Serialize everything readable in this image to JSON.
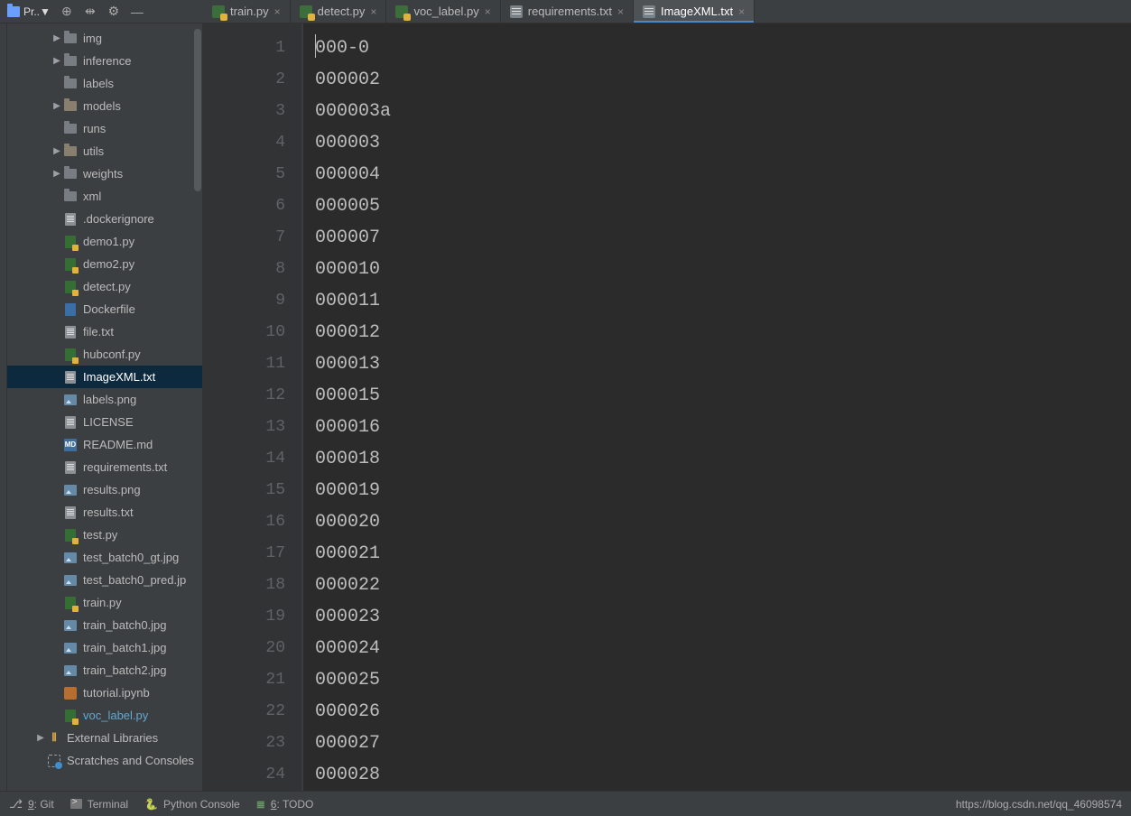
{
  "toolbar": {
    "project_label": "Pr..▼"
  },
  "tabs": [
    {
      "label": "train.py",
      "type": "py",
      "active": false
    },
    {
      "label": "detect.py",
      "type": "py",
      "active": false
    },
    {
      "label": "voc_label.py",
      "type": "py",
      "active": false
    },
    {
      "label": "requirements.txt",
      "type": "txt",
      "active": false
    },
    {
      "label": "ImageXML.txt",
      "type": "txt",
      "active": true
    }
  ],
  "tree": [
    {
      "indent": 1,
      "arrow": "right",
      "icon": "folder",
      "label": "img"
    },
    {
      "indent": 1,
      "arrow": "right",
      "icon": "folder",
      "label": "inference"
    },
    {
      "indent": 1,
      "arrow": "blank",
      "icon": "folder",
      "label": "labels"
    },
    {
      "indent": 1,
      "arrow": "right",
      "icon": "folderb",
      "label": "models"
    },
    {
      "indent": 1,
      "arrow": "blank",
      "icon": "folder",
      "label": "runs"
    },
    {
      "indent": 1,
      "arrow": "right",
      "icon": "folderb",
      "label": "utils"
    },
    {
      "indent": 1,
      "arrow": "right",
      "icon": "folder",
      "label": "weights"
    },
    {
      "indent": 1,
      "arrow": "blank",
      "icon": "folder",
      "label": "xml"
    },
    {
      "indent": 1,
      "arrow": "blank",
      "icon": "file",
      "label": ".dockerignore"
    },
    {
      "indent": 1,
      "arrow": "blank",
      "icon": "py",
      "label": "demo1.py"
    },
    {
      "indent": 1,
      "arrow": "blank",
      "icon": "py",
      "label": "demo2.py"
    },
    {
      "indent": 1,
      "arrow": "blank",
      "icon": "py",
      "label": "detect.py"
    },
    {
      "indent": 1,
      "arrow": "blank",
      "icon": "dfile",
      "label": "Dockerfile"
    },
    {
      "indent": 1,
      "arrow": "blank",
      "icon": "file",
      "label": "file.txt"
    },
    {
      "indent": 1,
      "arrow": "blank",
      "icon": "py",
      "label": "hubconf.py"
    },
    {
      "indent": 1,
      "arrow": "blank",
      "icon": "file",
      "label": "ImageXML.txt",
      "selected": true
    },
    {
      "indent": 1,
      "arrow": "blank",
      "icon": "img",
      "label": "labels.png"
    },
    {
      "indent": 1,
      "arrow": "blank",
      "icon": "file",
      "label": "LICENSE"
    },
    {
      "indent": 1,
      "arrow": "blank",
      "icon": "md",
      "label": "README.md"
    },
    {
      "indent": 1,
      "arrow": "blank",
      "icon": "file",
      "label": "requirements.txt"
    },
    {
      "indent": 1,
      "arrow": "blank",
      "icon": "img",
      "label": "results.png"
    },
    {
      "indent": 1,
      "arrow": "blank",
      "icon": "file",
      "label": "results.txt"
    },
    {
      "indent": 1,
      "arrow": "blank",
      "icon": "py",
      "label": "test.py"
    },
    {
      "indent": 1,
      "arrow": "blank",
      "icon": "img",
      "label": "test_batch0_gt.jpg"
    },
    {
      "indent": 1,
      "arrow": "blank",
      "icon": "img",
      "label": "test_batch0_pred.jp"
    },
    {
      "indent": 1,
      "arrow": "blank",
      "icon": "py",
      "label": "train.py"
    },
    {
      "indent": 1,
      "arrow": "blank",
      "icon": "img",
      "label": "train_batch0.jpg"
    },
    {
      "indent": 1,
      "arrow": "blank",
      "icon": "img",
      "label": "train_batch1.jpg"
    },
    {
      "indent": 1,
      "arrow": "blank",
      "icon": "img",
      "label": "train_batch2.jpg"
    },
    {
      "indent": 1,
      "arrow": "blank",
      "icon": "ipynb",
      "label": "tutorial.ipynb"
    },
    {
      "indent": 1,
      "arrow": "blank",
      "icon": "py",
      "label": "voc_label.py",
      "color": "#62a8d1"
    },
    {
      "indent": 0,
      "arrow": "right",
      "icon": "libs",
      "label": "External Libraries"
    },
    {
      "indent": 0,
      "arrow": "blank",
      "icon": "scratch",
      "label": "Scratches and Consoles"
    }
  ],
  "editor": {
    "lines": [
      "000-0",
      "000002",
      "000003a",
      "000003",
      "000004",
      "000005",
      "000007",
      "000010",
      "000011",
      "000012",
      "000013",
      "000015",
      "000016",
      "000018",
      "000019",
      "000020",
      "000021",
      "000022",
      "000023",
      "000024",
      "000025",
      "000026",
      "000027",
      "000028"
    ]
  },
  "bottom": {
    "git": {
      "key": "9",
      "label": "Git"
    },
    "terminal": "Terminal",
    "pyconsole": "Python Console",
    "todo": {
      "key": "6",
      "label": "TODO"
    },
    "url": "https://blog.csdn.net/qq_46098574"
  }
}
